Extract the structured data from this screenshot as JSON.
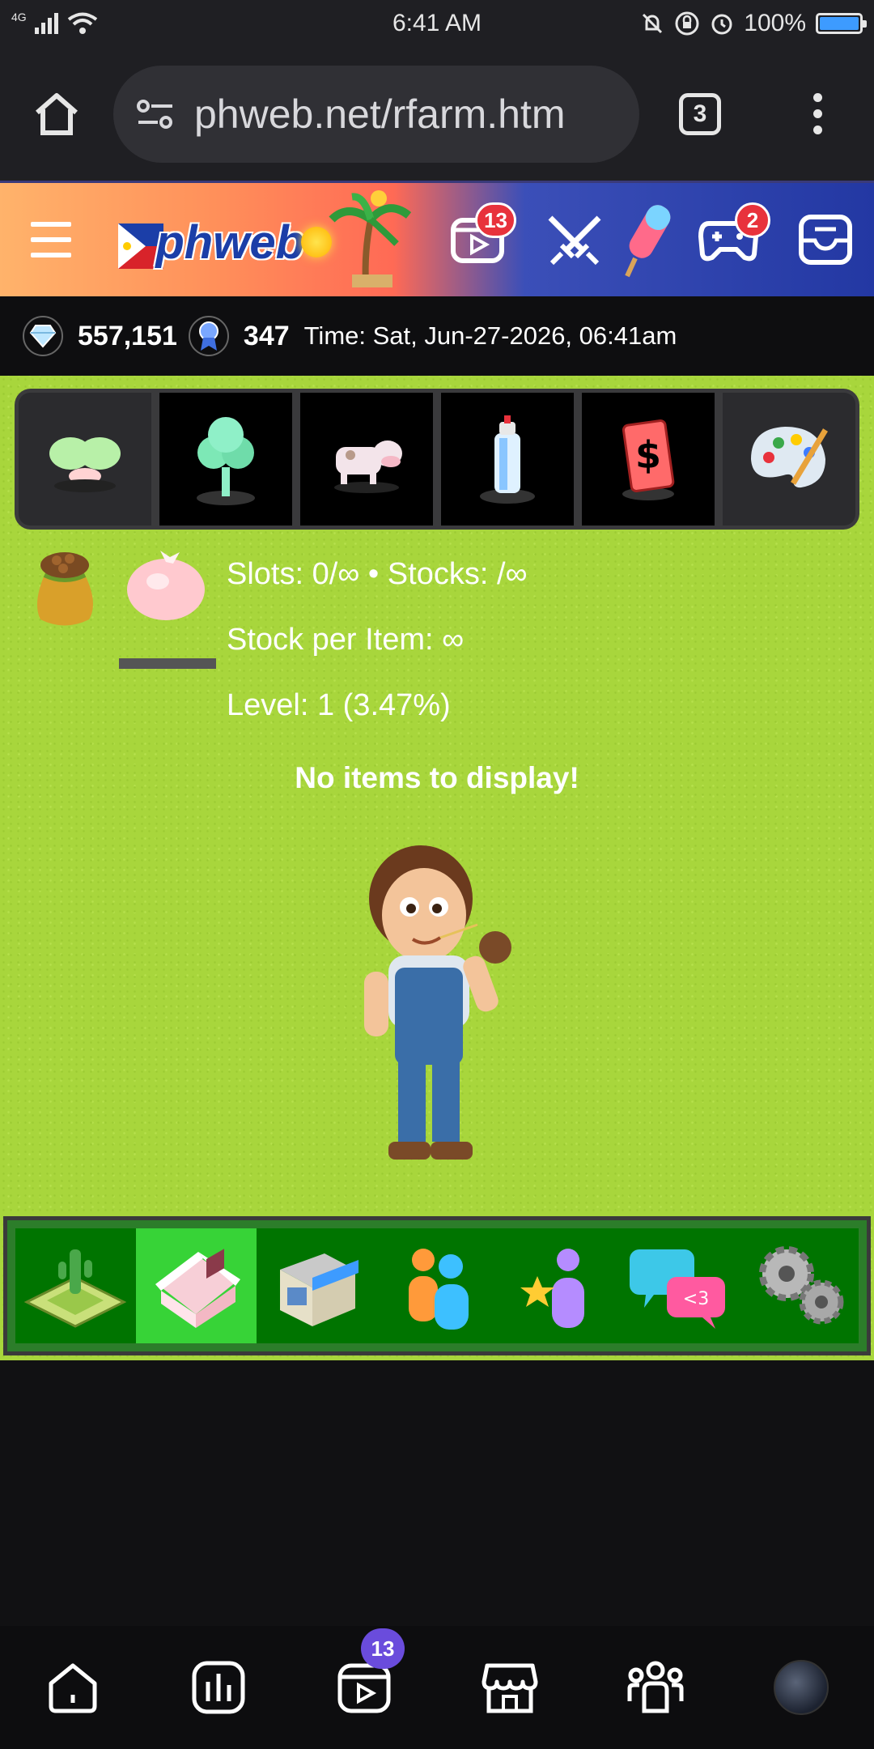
{
  "status_bar": {
    "network": "4G",
    "time": "6:41 AM",
    "battery": "100%",
    "battery_level": 1.0
  },
  "browser": {
    "url": "phweb.net/rfarm.htm",
    "tab_count": "3"
  },
  "banner": {
    "logo_text": "phweb",
    "icons": [
      {
        "name": "videos-icon",
        "badge": "13"
      },
      {
        "name": "battle-icon",
        "badge": ""
      },
      {
        "name": "games-icon",
        "badge": "2"
      },
      {
        "name": "inbox-icon",
        "badge": ""
      }
    ]
  },
  "stats": {
    "diamonds": "557,151",
    "medals": "347",
    "time": "Time: Sat, Jun-27-2026, 06:41am"
  },
  "categories": [
    {
      "name": "seedling",
      "active": true
    },
    {
      "name": "tree",
      "active": false
    },
    {
      "name": "cow",
      "active": false
    },
    {
      "name": "spray-can",
      "active": false
    },
    {
      "name": "money-card",
      "active": false
    },
    {
      "name": "paint-palette",
      "active": false
    }
  ],
  "info": {
    "slots": "Slots: 0/∞ • Stocks: /∞",
    "stock_per_item": "Stock per Item: ∞",
    "level": "Level: 1 (3.47%)",
    "empty_message": "No items to display!"
  },
  "bottom_tabs": [
    {
      "name": "farm-land",
      "active": false
    },
    {
      "name": "barn",
      "active": true
    },
    {
      "name": "shop",
      "active": false
    },
    {
      "name": "friends",
      "active": false
    },
    {
      "name": "favorites",
      "active": false
    },
    {
      "name": "messages",
      "active": false
    },
    {
      "name": "settings",
      "active": false
    }
  ],
  "nav": {
    "items": [
      "home-icon",
      "stats-icon",
      "reels-icon",
      "store-icon",
      "groups-icon",
      "profile-avatar"
    ],
    "reels_badge": "13"
  },
  "colors": {
    "grass": "#a8d63c",
    "bottom_bar": "#007400",
    "active_tab": "#37d337",
    "badge_red": "#e8323c",
    "badge_purple": "#6a4cdc",
    "battery_blue": "#3d9bff"
  }
}
